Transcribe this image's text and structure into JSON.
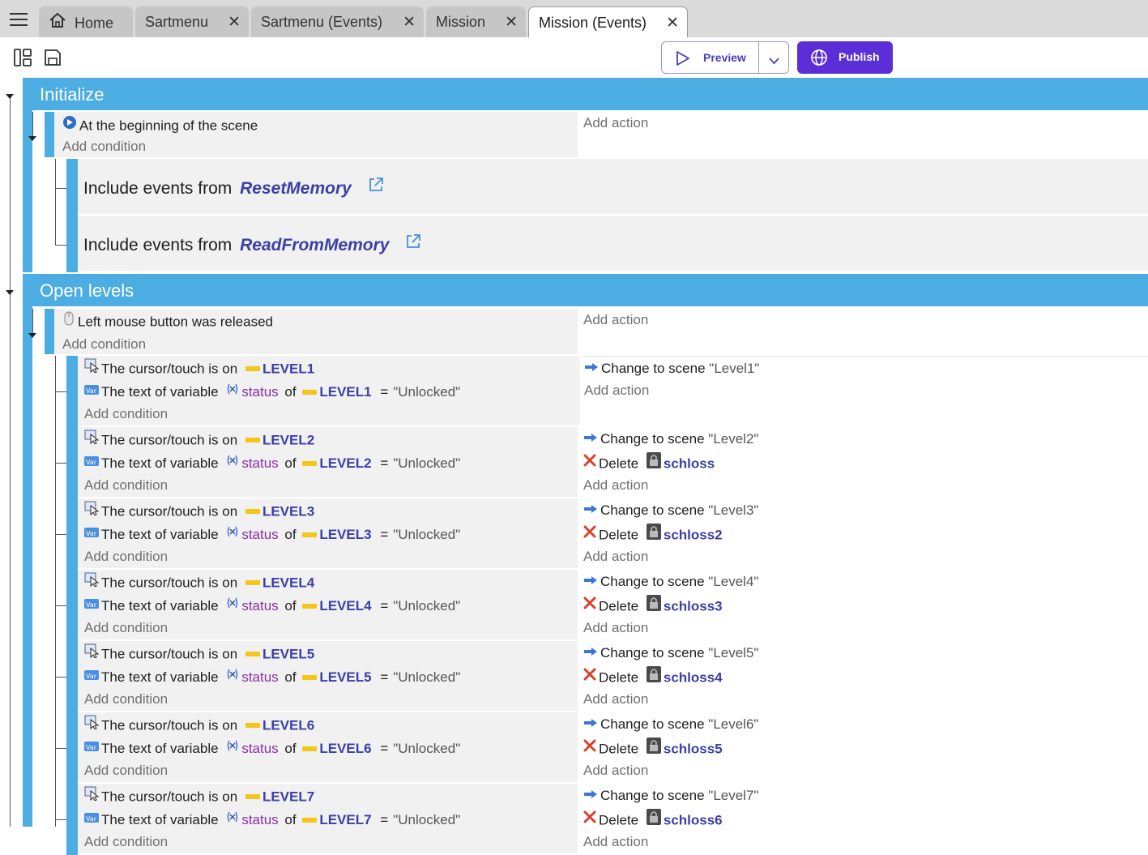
{
  "tabs": [
    {
      "label": "Home"
    },
    {
      "label": "Sartmenu"
    },
    {
      "label": "Sartmenu (Events)"
    },
    {
      "label": "Mission"
    },
    {
      "label": "Mission (Events)"
    }
  ],
  "toolbar": {
    "preview_label": "Preview",
    "publish_label": "Publish"
  },
  "colors": {
    "group_header": "#4cade2",
    "publish": "#5b2ed8",
    "object": "#3b3fa6",
    "variable": "#8b2fa8"
  },
  "icons": [
    "menu-icon",
    "home-icon",
    "close-icon",
    "layout-icon",
    "save-icon",
    "play-icon",
    "chevron-down-icon",
    "globe-icon",
    "scene-start-icon",
    "external-link-icon",
    "mouse-icon",
    "cursor-icon",
    "variable-icon",
    "sprite-icon",
    "change-scene-icon",
    "delete-icon",
    "lock-icon"
  ],
  "common": {
    "add_action": "Add action",
    "add_condition": "Add condition",
    "include_prefix": "Include events from",
    "cursor_text": "The cursor/touch is on",
    "var_text": "The text of variable",
    "var_name": "status",
    "of": "of",
    "eq": "=",
    "unlocked": "\"Unlocked\"",
    "change_scene": "Change to scene",
    "delete": "Delete"
  },
  "groups": {
    "initialize": {
      "title": "Initialize",
      "condition": "At the beginning of the scene",
      "includes": [
        "ResetMemory",
        "ReadFromMemory"
      ]
    },
    "open_levels": {
      "title": "Open levels",
      "condition": "Left mouse button was released",
      "events": [
        {
          "object": "LEVEL1",
          "scene": "\"Level1\"",
          "delete_object": ""
        },
        {
          "object": "LEVEL2",
          "scene": "\"Level2\"",
          "delete_object": "schloss"
        },
        {
          "object": "LEVEL3",
          "scene": "\"Level3\"",
          "delete_object": "schloss2"
        },
        {
          "object": "LEVEL4",
          "scene": "\"Level4\"",
          "delete_object": "schloss3"
        },
        {
          "object": "LEVEL5",
          "scene": "\"Level5\"",
          "delete_object": "schloss4"
        },
        {
          "object": "LEVEL6",
          "scene": "\"Level6\"",
          "delete_object": "schloss5"
        },
        {
          "object": "LEVEL7",
          "scene": "\"Level7\"",
          "delete_object": "schloss6"
        }
      ]
    }
  }
}
